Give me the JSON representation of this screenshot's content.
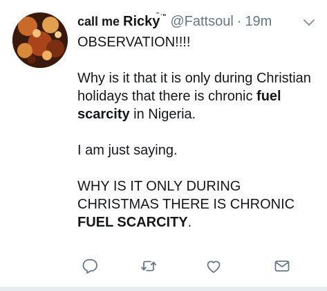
{
  "tweet": {
    "display_name_part1": "call me ",
    "display_name_part2": "Ricky",
    "display_name_flourish": "̃ˈʺ",
    "handle": "@Fattsoul",
    "separator": "·",
    "time": "19m",
    "lines": {
      "p1": "OBSERVATION!!!!",
      "p2a": "Why is it that it is only during Christian holidays that there is chronic ",
      "p2b": "fuel scarcity",
      "p2c": " in Nigeria.",
      "p3": "I am just saying.",
      "p4a": "WHY IS IT ONLY DURING CHRISTMAS THERE IS CHRONIC ",
      "p4b": "FUEL SCARCITY",
      "p4c": "."
    }
  },
  "icons": {
    "reply": "reply-icon",
    "retweet": "retweet-icon",
    "like": "heart-icon",
    "message": "envelope-icon",
    "caret": "chevron-down-icon"
  },
  "colors": {
    "text": "#14171a",
    "muted": "#657786",
    "icon": "#657786",
    "divider": "#e6ecf0"
  }
}
